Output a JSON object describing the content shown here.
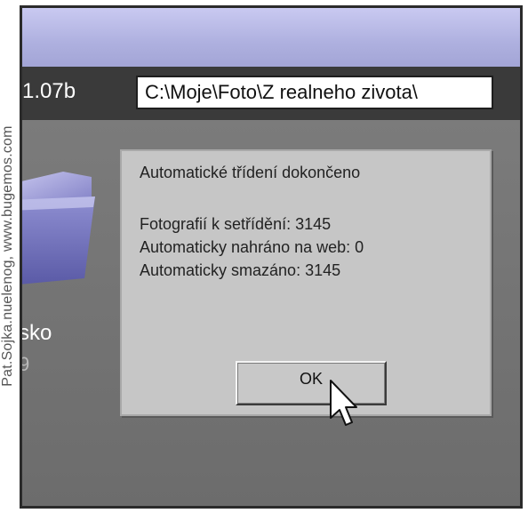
{
  "credit": {
    "text": "Pat.Sojka.nuelenog, www.bugemos.com"
  },
  "app": {
    "version": "1.07b",
    "path": "C:\\Moje\\Foto\\Z realneho zivota\\"
  },
  "folder": {
    "label": "sko",
    "sublabel": "9"
  },
  "dialog": {
    "title": "Automatické třídení dokončeno",
    "lines": [
      "Fotografií k setřídění: 3145",
      "Automaticky nahráno na web: 0",
      "Automaticky smazáno: 3145"
    ],
    "ok_label": "OK"
  },
  "colors": {
    "titlebar": "#aeb0df",
    "workspace": "#707070",
    "dialog": "#c6c6c6"
  },
  "icons": {
    "folder": "folder-icon",
    "cursor": "mouse-cursor-icon"
  }
}
